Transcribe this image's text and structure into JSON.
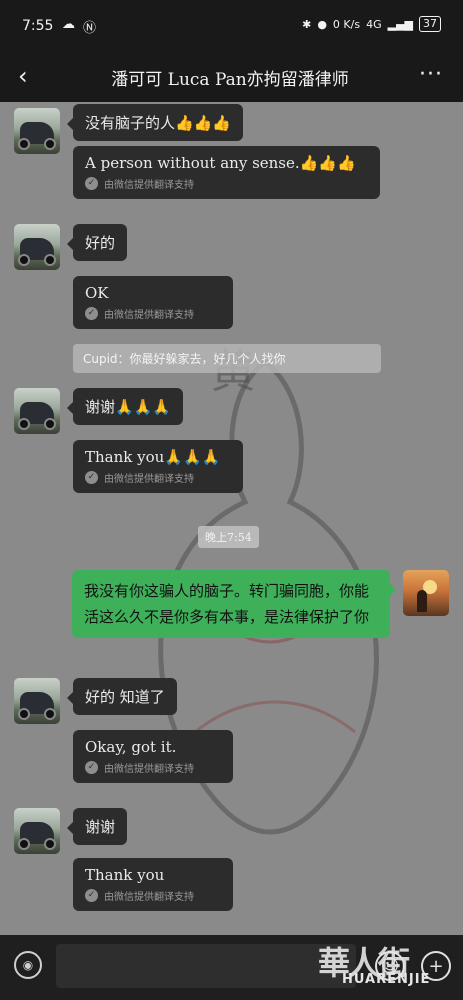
{
  "status_bar": {
    "time": "7:55",
    "network": "4G",
    "speed": "0 K/s",
    "battery": "37"
  },
  "header": {
    "back_icon": "chevron-left-icon",
    "title": "潘可可 Luca Pan亦拘留潘律师",
    "more_icon": "ellipsis-icon"
  },
  "messages": [
    {
      "from": "other",
      "text": "没有脑子的人👍👍👍"
    },
    {
      "from": "other",
      "text": "A person without any sense.👍👍👍",
      "note": "由微信提供翻译支持"
    },
    {
      "from": "other",
      "text": "好的"
    },
    {
      "from": "other",
      "text": "OK",
      "note": "由微信提供翻译支持"
    },
    {
      "from": "system",
      "text": "Cupid：你最好躲家去，好几个人找你"
    },
    {
      "from": "other",
      "text": "谢谢🙏🙏🙏"
    },
    {
      "from": "other",
      "text": "Thank you🙏🙏🙏",
      "note": "由微信提供翻译支持"
    },
    {
      "from": "time",
      "text": "晚上7:54"
    },
    {
      "from": "self",
      "text": "我没有你这骗人的脑子。转门骗同胞，你能活这么久不是你多有本事，是法律保护了你"
    },
    {
      "from": "other",
      "text": "好的 知道了"
    },
    {
      "from": "other",
      "text": "Okay, got it.",
      "note": "由微信提供翻译支持"
    },
    {
      "from": "other",
      "text": "谢谢"
    },
    {
      "from": "other",
      "text": "Thank you",
      "note": "由微信提供翻译支持"
    }
  ],
  "input_bar": {
    "placeholder": "",
    "voice_icon": "voice-icon",
    "emoji_icon": "emoji-icon",
    "plus_icon": "plus-icon"
  },
  "watermark": {
    "logo": "華人街",
    "sub": "HUARENJIE"
  },
  "colors": {
    "bar_bg": "#191919",
    "bubble_dark": "#2c2c2c",
    "bubble_green": "#3fb05a"
  }
}
